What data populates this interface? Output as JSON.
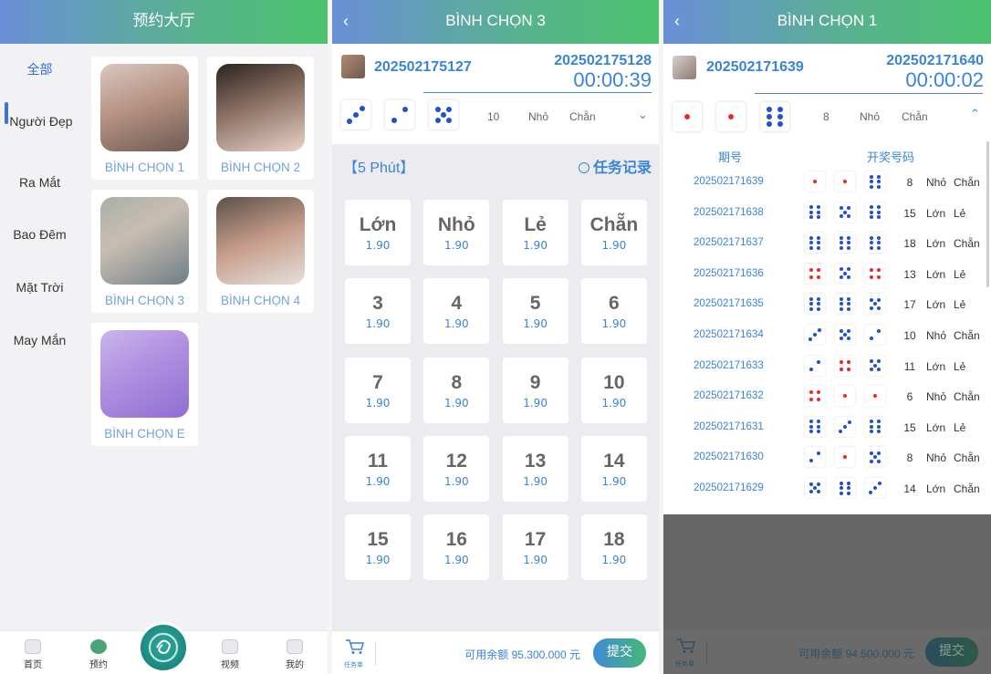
{
  "colors": {
    "accent_blue": "#3a84d6",
    "pip_red": "#e62b2b",
    "pip_blue": "#1f50d6",
    "header_from": "#6a8fd8",
    "header_to": "#4cc36e"
  },
  "hall": {
    "title": "预约大厅",
    "categories": [
      "全部",
      "Người Đẹp",
      "Ra Mắt",
      "Bao Đêm",
      "Mặt Trời",
      "May Mắn"
    ],
    "cards": [
      {
        "label": "BÌNH CHỌN 1"
      },
      {
        "label": "BÌNH CHỌN 2"
      },
      {
        "label": "BÌNH CHỌN 3"
      },
      {
        "label": "BÌNH CHỌN 4"
      },
      {
        "label": "BÌNH CHỌN E"
      }
    ],
    "nav": {
      "home": "首页",
      "reserve": "预约",
      "video": "视频",
      "mine": "我的"
    }
  },
  "vote3": {
    "title": "BÌNH CHỌN 3",
    "last_issue": "202502175127",
    "next_issue": "202502175128",
    "countdown": "00:00:39",
    "last_dice": [
      3,
      2,
      5
    ],
    "last_sum": "10",
    "last_size": "Nhỏ",
    "last_parity": "Chẵn",
    "mode": "【5 Phút】",
    "record": "任务记录",
    "bets": [
      {
        "name": "Lớn",
        "odds": "1.90"
      },
      {
        "name": "Nhỏ",
        "odds": "1.90"
      },
      {
        "name": "Lẻ",
        "odds": "1.90"
      },
      {
        "name": "Chẵn",
        "odds": "1.90"
      },
      {
        "name": "3",
        "odds": "1.90"
      },
      {
        "name": "4",
        "odds": "1.90"
      },
      {
        "name": "5",
        "odds": "1.90"
      },
      {
        "name": "6",
        "odds": "1.90"
      },
      {
        "name": "7",
        "odds": "1.90"
      },
      {
        "name": "8",
        "odds": "1.90"
      },
      {
        "name": "9",
        "odds": "1.90"
      },
      {
        "name": "10",
        "odds": "1.90"
      },
      {
        "name": "11",
        "odds": "1.90"
      },
      {
        "name": "12",
        "odds": "1.90"
      },
      {
        "name": "13",
        "odds": "1.90"
      },
      {
        "name": "14",
        "odds": "1.90"
      },
      {
        "name": "15",
        "odds": "1.90"
      },
      {
        "name": "16",
        "odds": "1.90"
      },
      {
        "name": "17",
        "odds": "1.90"
      },
      {
        "name": "18",
        "odds": "1.90"
      }
    ],
    "cart_label": "任务单",
    "balance": "可用余额 95.300.000 元",
    "submit": "提交"
  },
  "vote1": {
    "title": "BÌNH CHỌN 1",
    "last_issue": "202502171639",
    "next_issue": "202502171640",
    "countdown": "00:00:02",
    "last_dice": [
      1,
      1,
      6
    ],
    "last_sum": "8",
    "last_size": "Nhỏ",
    "last_parity": "Chẵn",
    "col_issue": "期号",
    "col_numbers": "开奖号码",
    "history": [
      {
        "id": "202502171639",
        "dice": [
          1,
          1,
          6
        ],
        "sum": "8",
        "size": "Nhỏ",
        "parity": "Chẵn"
      },
      {
        "id": "202502171638",
        "dice": [
          6,
          5,
          6
        ],
        "sum": "15",
        "size": "Lớn",
        "parity": "Lẻ"
      },
      {
        "id": "202502171637",
        "dice": [
          6,
          6,
          6
        ],
        "sum": "18",
        "size": "Lớn",
        "parity": "Chẵn"
      },
      {
        "id": "202502171636",
        "dice": [
          4,
          5,
          4
        ],
        "sum": "13",
        "size": "Lớn",
        "parity": "Lẻ"
      },
      {
        "id": "202502171635",
        "dice": [
          6,
          6,
          5
        ],
        "sum": "17",
        "size": "Lớn",
        "parity": "Lẻ"
      },
      {
        "id": "202502171634",
        "dice": [
          3,
          5,
          2
        ],
        "sum": "10",
        "size": "Nhỏ",
        "parity": "Chẵn"
      },
      {
        "id": "202502171633",
        "dice": [
          2,
          4,
          5
        ],
        "sum": "11",
        "size": "Lớn",
        "parity": "Lẻ"
      },
      {
        "id": "202502171632",
        "dice": [
          4,
          1,
          1
        ],
        "sum": "6",
        "size": "Nhỏ",
        "parity": "Chẵn"
      },
      {
        "id": "202502171631",
        "dice": [
          6,
          3,
          6
        ],
        "sum": "15",
        "size": "Lớn",
        "parity": "Lẻ"
      },
      {
        "id": "202502171630",
        "dice": [
          2,
          1,
          5
        ],
        "sum": "8",
        "size": "Nhỏ",
        "parity": "Chẵn"
      },
      {
        "id": "202502171629",
        "dice": [
          5,
          6,
          3
        ],
        "sum": "14",
        "size": "Lớn",
        "parity": "Chẵn"
      }
    ],
    "cart_label": "任务单",
    "balance": "可用余额 94.500.000 元",
    "submit": "提交"
  }
}
